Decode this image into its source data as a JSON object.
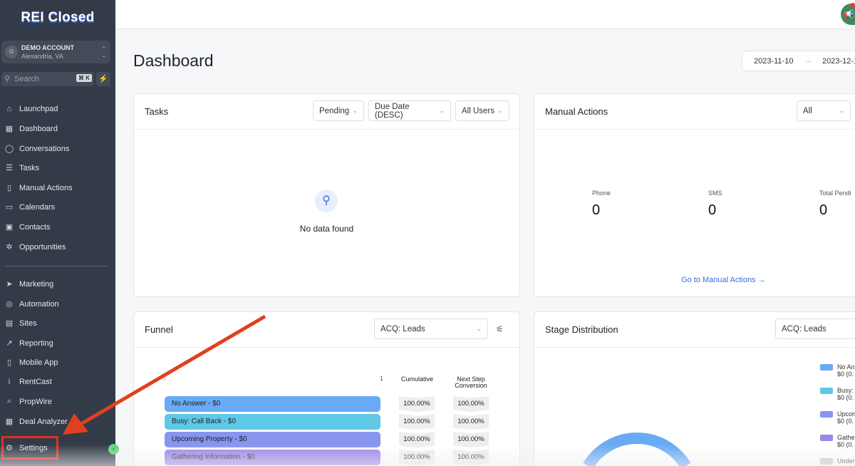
{
  "app": {
    "logo": "REI Closed"
  },
  "account": {
    "name": "DEMO ACCOUNT",
    "location": "Alexandria, VA"
  },
  "search": {
    "placeholder": "Search",
    "shortcut": "⌘ K"
  },
  "nav_primary": [
    {
      "label": "Launchpad",
      "icon": "⌂"
    },
    {
      "label": "Dashboard",
      "icon": "▦"
    },
    {
      "label": "Conversations",
      "icon": "◯"
    },
    {
      "label": "Tasks",
      "icon": "☰"
    },
    {
      "label": "Manual Actions",
      "icon": "▯"
    },
    {
      "label": "Calendars",
      "icon": "▭"
    },
    {
      "label": "Contacts",
      "icon": "▣"
    },
    {
      "label": "Opportunities",
      "icon": "✲"
    }
  ],
  "nav_secondary": [
    {
      "label": "Marketing",
      "icon": "➤"
    },
    {
      "label": "Automation",
      "icon": "◎"
    },
    {
      "label": "Sites",
      "icon": "▤"
    },
    {
      "label": "Reporting",
      "icon": "↗"
    },
    {
      "label": "Mobile App",
      "icon": "▯"
    },
    {
      "label": "RentCast",
      "icon": "i"
    },
    {
      "label": "PropWire",
      "icon": "⌕"
    },
    {
      "label": "Deal Analyzer",
      "icon": "▦"
    }
  ],
  "settings": {
    "label": "Settings",
    "icon": "⚙"
  },
  "page": {
    "title": "Dashboard",
    "date_from": "2023-11-10",
    "date_to": "2023-12-1"
  },
  "tasks": {
    "title": "Tasks",
    "filters": [
      "Pending",
      "Due Date (DESC)",
      "All Users"
    ],
    "empty": "No data found"
  },
  "manual_actions": {
    "title": "Manual Actions",
    "filter": "All",
    "stats": [
      {
        "label": "Phone",
        "value": "0"
      },
      {
        "label": "SMS",
        "value": "0"
      },
      {
        "label": "Total Pendi",
        "value": "0"
      }
    ],
    "link": "Go to Manual Actions →"
  },
  "funnel": {
    "title": "Funnel",
    "pipeline": "ACQ: Leads",
    "axis_min": "0",
    "axis_max": "1",
    "col_cumulative": "Cumulative",
    "col_next": "Next Step Conversion",
    "rows": [
      {
        "label": "No Answer - $0",
        "color": "#69aaf5",
        "cumulative": "100.00%",
        "next": "100.00%"
      },
      {
        "label": "Busy: Call Back - $0",
        "color": "#5ec8e6",
        "cumulative": "100.00%",
        "next": "100.00%"
      },
      {
        "label": "Upcoming Property - $0",
        "color": "#8895ef",
        "cumulative": "100.00%",
        "next": "100.00%"
      },
      {
        "label": "Gathering Information - $0",
        "color": "#9b86ea",
        "cumulative": "100.00%",
        "next": "100.00%"
      }
    ]
  },
  "stage": {
    "title": "Stage Distribution",
    "pipeline": "ACQ: Leads",
    "legend": [
      {
        "name": "No An",
        "value": "$0 (0.",
        "color": "#69aaf5"
      },
      {
        "name": "Busy:",
        "value": "$0 (0.",
        "color": "#5ec8e6"
      },
      {
        "name": "Upcon",
        "value": "$0 (0.",
        "color": "#8895ef"
      },
      {
        "name": "Gathe",
        "value": "$0 (0.",
        "color": "#9b86ea"
      },
      {
        "name": "Under",
        "value": "",
        "color": "#cccccc"
      }
    ]
  }
}
